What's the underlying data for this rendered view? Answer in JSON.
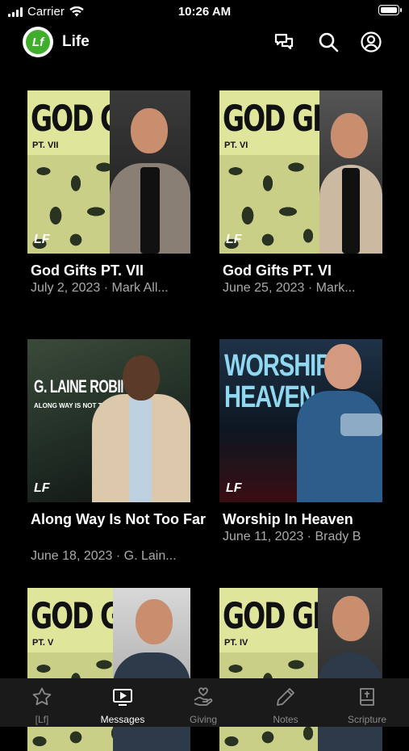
{
  "status_bar": {
    "carrier": "Carrier",
    "time": "10:26 AM"
  },
  "header": {
    "logo_text": "Lf",
    "title": "Life"
  },
  "messages": [
    {
      "title": "God Gifts PT. VII",
      "meta": "July 2, 2023 · Mark All...",
      "art_title": "GOD GIFTS",
      "art_sub": "PT. VII"
    },
    {
      "title": "God Gifts PT. VI",
      "meta": "June 25, 2023 · Mark...",
      "art_title": "GOD GIFTS",
      "art_sub": "PT. VI"
    },
    {
      "title": "Along Way Is Not Too Far",
      "meta": "June 18, 2023 · G. Lain...",
      "art_title": "G. LAINE ROBINSON",
      "art_sub": "ALONG WAY IS NOT TOO FAR"
    },
    {
      "title": "Worship In Heaven",
      "meta": "June 11, 2023 · Brady B",
      "art_title": "WORSHIP IN HEAVEN",
      "art_sub": ""
    },
    {
      "title": "",
      "meta": "",
      "art_title": "GOD GIFTS",
      "art_sub": "PT. V"
    },
    {
      "title": "",
      "meta": "",
      "art_title": "GOD GIFTS",
      "art_sub": "PT. IV"
    }
  ],
  "thumb_logo": "LF",
  "tabs": [
    {
      "label": "[Lf]",
      "icon": "star-icon",
      "active": false
    },
    {
      "label": "Messages",
      "icon": "tv-icon",
      "active": true
    },
    {
      "label": "Giving",
      "icon": "giving-hand-icon",
      "active": false
    },
    {
      "label": "Notes",
      "icon": "pencil-icon",
      "active": false
    },
    {
      "label": "Scripture",
      "icon": "bible-icon",
      "active": false
    }
  ],
  "colors": {
    "background": "#000000",
    "tabbar": "#1a1a1a",
    "accent": "#3fae2a",
    "meta_text": "#aaaaaa"
  }
}
